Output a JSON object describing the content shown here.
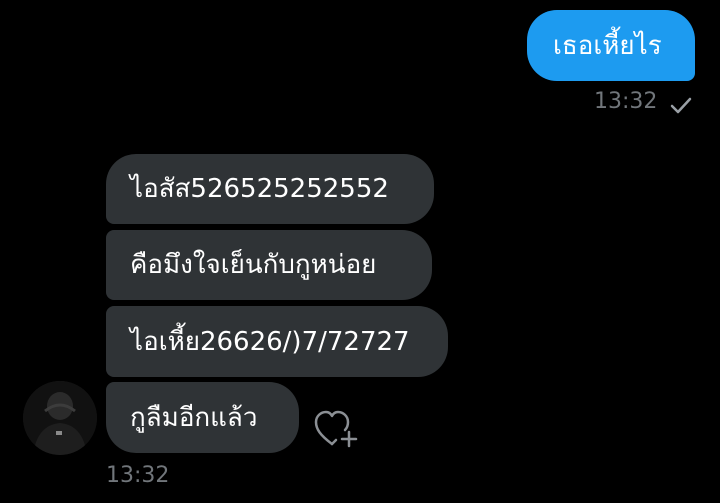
{
  "conversation": {
    "sent_messages": [
      {
        "text": "เธอเหี้ยไร",
        "time": "13:32",
        "status": "sent-check"
      }
    ],
    "received_messages": [
      {
        "text": "ไอสัส526525252552"
      },
      {
        "text": "คือมึงใจเย็นกับกูหน่อย"
      },
      {
        "text": "ไอเหี้ย26626/)7/72727"
      },
      {
        "text": "กูลืมอีกแล้ว"
      }
    ],
    "received_time": "13:32"
  },
  "icons": {
    "delivered": "checkmark-icon",
    "avatar": "user-avatar",
    "reaction": "heart-plus-icon"
  },
  "colors": {
    "background": "#000000",
    "sent_bubble": "#1d9bf0",
    "received_bubble": "#2f3336",
    "meta_text": "#71767b"
  }
}
